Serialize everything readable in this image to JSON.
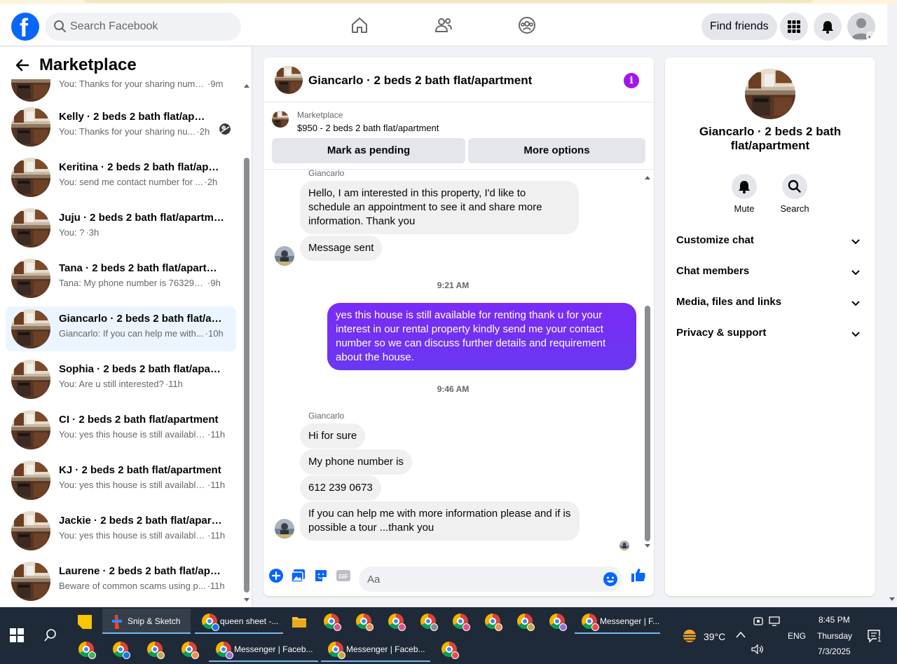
{
  "navbar": {
    "search_placeholder": "Search Facebook",
    "find_friends": "Find friends",
    "brand_color": "#0866ff"
  },
  "sidebar": {
    "title": "Marketplace",
    "conversations": [
      {
        "name": "",
        "preview": "You: Thanks for your sharing numb...",
        "time": "9m",
        "active": false
      },
      {
        "name": "Kelly · 2 beds 2 bath flat/apartment",
        "preview": "You: Thanks for your sharing nu...",
        "time": "2h",
        "active": false
      },
      {
        "name": "Keritina · 2 beds 2 bath flat/apartment",
        "preview": "You: send me contact number for ...",
        "time": "2h",
        "active": false
      },
      {
        "name": "Juju · 2 beds 2 bath flat/apartment",
        "preview": "You: ?",
        "time": "3h",
        "active": false
      },
      {
        "name": "Tana · 2 beds 2 bath flat/apartment",
        "preview": "Tana: My phone number is 7632921...",
        "time": "9h",
        "active": false
      },
      {
        "name": "Giancarlo · 2 beds 2 bath flat/apartment",
        "preview": "Giancarlo: If you can help me with...",
        "time": "10h",
        "active": true
      },
      {
        "name": "Sophia · 2 beds 2 bath flat/apartment",
        "preview": "You: Are u still interested?",
        "time": "11h",
        "active": false
      },
      {
        "name": "CI · 2 beds 2 bath flat/apartment",
        "preview": "You: yes this house is still available...",
        "time": "11h",
        "active": false
      },
      {
        "name": "KJ · 2 beds 2 bath flat/apartment",
        "preview": "You: yes this house is still available...",
        "time": "11h",
        "active": false
      },
      {
        "name": "Jackie · 2 beds 2 bath flat/apartment",
        "preview": "You: yes this house is still available...",
        "time": "11h",
        "active": false
      },
      {
        "name": "Laurene · 2 beds 2 bath flat/apartment",
        "preview": "Beware of common scams using p...",
        "time": "11h",
        "active": false
      }
    ]
  },
  "chat": {
    "title": "Giancarlo · 2 beds 2 bath flat/apartment",
    "listing_source": "Marketplace",
    "listing_price": "$950 - 2 beds 2 bath flat/apartment",
    "mark_pending": "Mark as pending",
    "more_options": "More options",
    "sender1": "Giancarlo",
    "msg1": "Hello, I am interested in this property, I'd like to schedule an appointment to see it and share more information. Thank you",
    "msg2": "Message sent",
    "time1": "9:21 AM",
    "msg_out": "yes this house is still  available for renting thank u for your interest  in our rental property kindly send me your contact number so we can discuss further details and requirement about the house.",
    "time2": "9:46 AM",
    "sender2": "Giancarlo",
    "msg3": "Hi for sure",
    "msg4": "My phone number is",
    "msg5": "612 239 0673",
    "msg6": "If you can help me with more information please and if is possible a tour ...thank you",
    "composer_placeholder": "Aa",
    "outgoing_color": "#7a2bf5"
  },
  "details": {
    "name": "Giancarlo · 2 beds 2 bath flat/apartment",
    "mute": "Mute",
    "search": "Search",
    "sections": [
      "Customize chat",
      "Chat members",
      "Media, files and links",
      "Privacy & support"
    ]
  },
  "taskbar": {
    "snip": "Snip & Sketch",
    "queen": "queen sheet -...",
    "messenger1": "Messenger | F...",
    "messenger2": "Messenger | Faceb...",
    "messenger3": "Messenger | Faceb...",
    "temp": "39°C",
    "lang": "ENG",
    "time": "8:45 PM",
    "day": "Thursday",
    "date": "7/3/2025",
    "notif_count": "1"
  }
}
